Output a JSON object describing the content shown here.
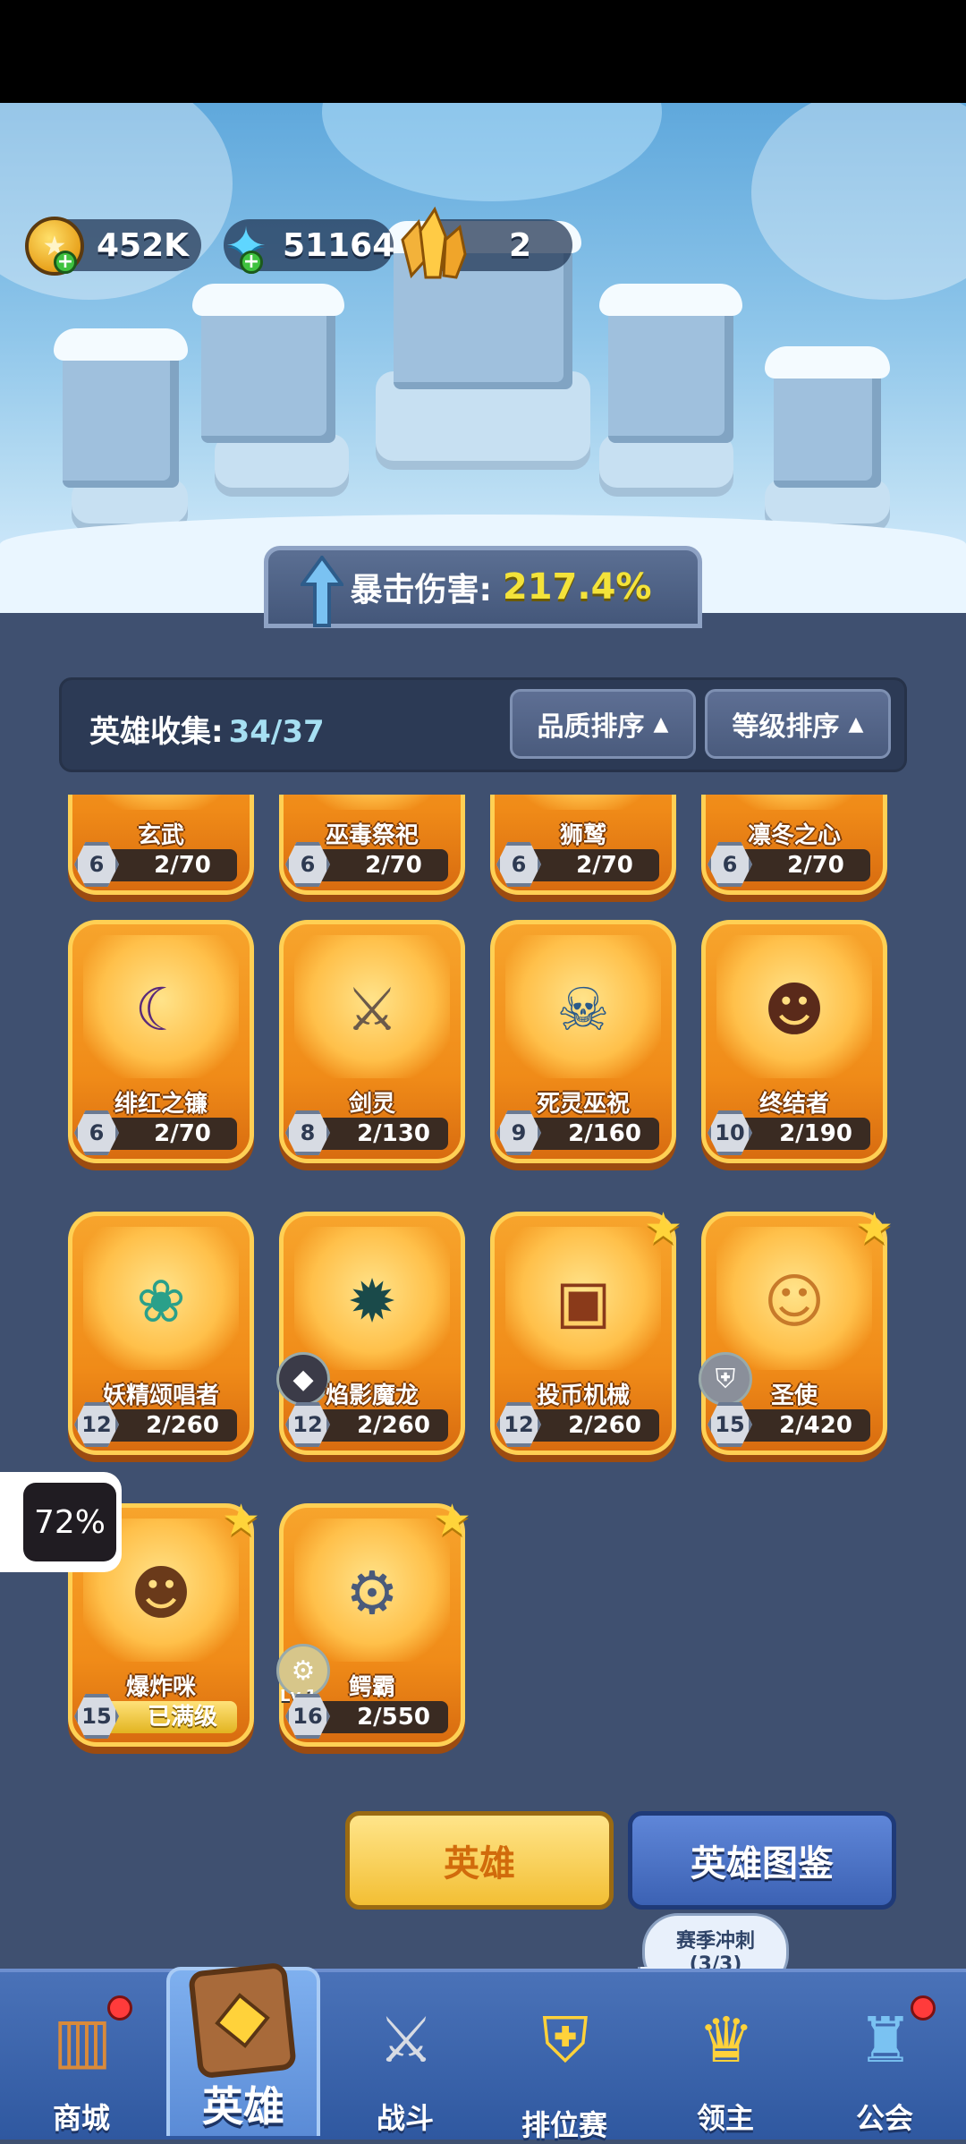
{
  "currency": {
    "gold": "452K",
    "gems": "51164",
    "crystals": "2"
  },
  "crit": {
    "label": "暴击伤害:",
    "value": "217.4%"
  },
  "collection": {
    "label": "英雄收集:",
    "count": "34/37",
    "sort_quality": "品质排序",
    "sort_level": "等级排序",
    "sort_arrow": "▲"
  },
  "heroes": [
    {
      "name": "玄武",
      "level": "6",
      "progress": "2/70",
      "icon": "tortoise-icon"
    },
    {
      "name": "巫毒祭祀",
      "level": "6",
      "progress": "2/70",
      "icon": "voodoo-icon"
    },
    {
      "name": "狮鹫",
      "level": "6",
      "progress": "2/70",
      "icon": "griffin-icon"
    },
    {
      "name": "凛冬之心",
      "level": "6",
      "progress": "2/70",
      "icon": "winter-icon"
    },
    {
      "name": "绯红之镰",
      "level": "6",
      "progress": "2/70",
      "icon": "scythe-icon"
    },
    {
      "name": "剑灵",
      "level": "8",
      "progress": "2/130",
      "icon": "sword-spirit-icon"
    },
    {
      "name": "死灵巫祝",
      "level": "9",
      "progress": "2/160",
      "icon": "necromancer-icon"
    },
    {
      "name": "终结者",
      "level": "10",
      "progress": "2/190",
      "icon": "terminator-icon"
    },
    {
      "name": "妖精颂唱者",
      "level": "12",
      "progress": "2/260",
      "icon": "fairy-icon"
    },
    {
      "name": "焰影魔龙",
      "level": "12",
      "progress": "2/260",
      "icon": "dragon-icon"
    },
    {
      "name": "投币机械",
      "level": "12",
      "progress": "2/260",
      "icon": "coin-machine-icon"
    },
    {
      "name": "圣使",
      "level": "15",
      "progress": "2/420",
      "icon": "angel-icon"
    },
    {
      "name": "爆炸咪",
      "level": "15",
      "progress": "已满级",
      "icon": "cat-icon"
    },
    {
      "name": "鳄霸",
      "level": "16",
      "progress": "2/550",
      "icon": "croc-mech-icon"
    }
  ],
  "badge_lv": "Lv.1",
  "actions": {
    "hero": "英雄",
    "codex": "英雄图鉴"
  },
  "float_percent": "72%",
  "season_bubble": {
    "line1": "赛季冲刺",
    "line2": "(3/3)"
  },
  "nav": {
    "shop": "商城",
    "hero": "英雄",
    "battle": "战斗",
    "ranked": "排位赛",
    "lord": "领主",
    "guild": "公会"
  }
}
